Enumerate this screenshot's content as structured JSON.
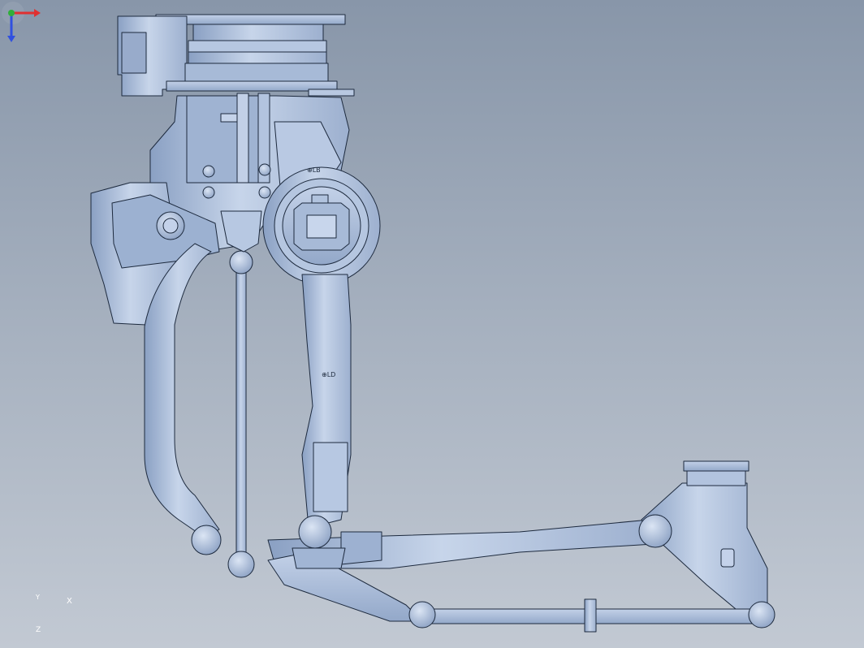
{
  "viewport": {
    "background_top": "#8896a9",
    "background_bottom": "#c2c9d3",
    "part_fill": "#a9bbd6",
    "part_shade": "#8aa0c3",
    "part_light": "#c7d5ea",
    "edge_color": "#1d2a3e"
  },
  "model": {
    "engraved_marks": {
      "top_mark": "⊕LB",
      "arm_mark": "⊕LD"
    }
  },
  "triad": {
    "x_label": "X",
    "y_label": "Y",
    "z_label": "Z",
    "x_color": "#e03030",
    "y_color": "#2fb03a",
    "z_color": "#3050e0"
  }
}
